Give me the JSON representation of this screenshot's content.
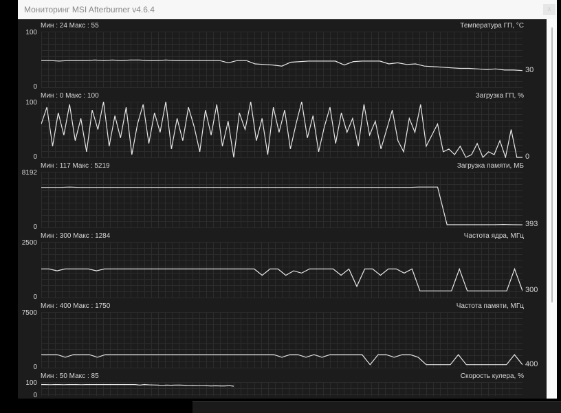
{
  "window": {
    "title": "Мониторинг MSI Afterburner v4.6.4",
    "close": "x"
  },
  "graphs": [
    {
      "name": "Температура ГП, °C",
      "min_max": "Мин : 24   Макс : 55",
      "ymax": "100",
      "ymin": "0",
      "current": "30",
      "range": [
        0,
        100
      ],
      "values": [
        48,
        48,
        47,
        48,
        48,
        48,
        49,
        48,
        49,
        48,
        49,
        49,
        48,
        48,
        49,
        48,
        48,
        48,
        48,
        48,
        48,
        44,
        48,
        48,
        42,
        41,
        40,
        38,
        45,
        46,
        47,
        47,
        47,
        47,
        40,
        46,
        47,
        47,
        47,
        42,
        44,
        41,
        42,
        38,
        37,
        36,
        35,
        34,
        34,
        33,
        32,
        33,
        31,
        31,
        30
      ]
    },
    {
      "name": "Загрузка ГП, %",
      "min_max": "Мин : 0   Макс : 100",
      "ymax": "100",
      "ymin": "0",
      "current": "0",
      "range": [
        0,
        100
      ],
      "values": [
        60,
        90,
        20,
        80,
        40,
        95,
        30,
        70,
        10,
        85,
        50,
        100,
        20,
        75,
        35,
        90,
        5,
        60,
        95,
        25,
        80,
        45,
        100,
        15,
        70,
        30,
        90,
        55,
        10,
        85,
        40,
        95,
        20,
        65,
        0,
        80,
        50,
        100,
        30,
        70,
        5,
        90,
        45,
        85,
        15,
        60,
        100,
        35,
        75,
        10,
        55,
        90,
        25,
        80,
        45,
        70,
        20,
        95,
        40,
        65,
        15,
        50,
        85,
        30,
        10,
        70,
        45,
        95,
        20,
        40,
        60,
        10,
        15,
        5,
        20,
        0,
        5,
        25,
        0,
        10,
        5,
        30,
        0,
        50,
        0,
        0
      ]
    },
    {
      "name": "Загрузка памяти, МБ",
      "min_max": "Мин : 117   Макс : 5219",
      "ymax": "8192",
      "ymin": "0",
      "current": "393",
      "range": [
        0,
        8192
      ],
      "values": [
        5900,
        5900,
        5900,
        5950,
        5900,
        5900,
        5900,
        5900,
        5900,
        5900,
        5900,
        5900,
        5900,
        5900,
        5900,
        5900,
        5900,
        5900,
        5900,
        5900,
        5900,
        5900,
        5900,
        5900,
        5900,
        5900,
        5900,
        5900,
        5900,
        5900,
        5900,
        5900,
        5900,
        5900,
        5900,
        5900,
        5900,
        5900,
        5900,
        5900,
        5950,
        5950,
        5950,
        400,
        400,
        400,
        400,
        400,
        400,
        450,
        400,
        393
      ]
    },
    {
      "name": "Частота ядра, МГц",
      "min_max": "Мин : 300   Макс : 1284",
      "ymax": "2500",
      "ymin": "0",
      "current": "300",
      "range": [
        0,
        2500
      ],
      "values": [
        1284,
        1284,
        1200,
        1284,
        1284,
        1284,
        1284,
        1200,
        1284,
        1284,
        1284,
        1284,
        1284,
        1284,
        1284,
        1284,
        1284,
        1284,
        1284,
        1284,
        1284,
        1284,
        1284,
        1284,
        1284,
        1284,
        1284,
        1284,
        1000,
        1284,
        1284,
        1000,
        1200,
        1100,
        1284,
        1284,
        1284,
        1284,
        1000,
        1284,
        500,
        1284,
        1284,
        1000,
        1284,
        1284,
        1100,
        1284,
        300,
        300,
        300,
        300,
        300,
        1284,
        300,
        300,
        300,
        300,
        300,
        300,
        1284,
        300
      ]
    },
    {
      "name": "Частота памяти, МГц",
      "min_max": "Мин : 400   Макс : 1750",
      "ymax": "7500",
      "ymin": "0",
      "current": "400",
      "range": [
        0,
        7500
      ],
      "values": [
        1750,
        1750,
        1750,
        1400,
        1750,
        1750,
        1750,
        1400,
        1750,
        1750,
        1750,
        1750,
        1750,
        1750,
        1750,
        1750,
        1750,
        1750,
        1750,
        1750,
        1750,
        1750,
        1750,
        1750,
        1750,
        1750,
        1750,
        1750,
        1750,
        1750,
        1400,
        1750,
        1750,
        1400,
        1750,
        1400,
        1750,
        1750,
        1750,
        1750,
        1750,
        400,
        1750,
        1750,
        1400,
        1750,
        1750,
        1400,
        400,
        400,
        400,
        400,
        1750,
        400,
        400,
        400,
        400,
        400,
        400,
        1750,
        400
      ]
    },
    {
      "name": "Скорость кулера, %",
      "min_max": "Мин : 50   Макс : 85",
      "ymax": "100",
      "ymin": "0",
      "current": "",
      "range": [
        0,
        100
      ],
      "values": [
        82,
        82,
        81,
        82,
        82,
        81,
        82,
        82,
        82,
        81,
        82,
        82,
        82,
        82,
        82,
        82,
        82,
        82,
        82,
        82,
        82,
        82,
        78,
        82,
        80,
        79,
        78,
        76,
        78,
        77,
        78,
        78,
        77,
        76,
        75,
        74,
        74,
        73,
        72,
        73,
        72,
        72,
        74,
        70
      ]
    }
  ]
}
